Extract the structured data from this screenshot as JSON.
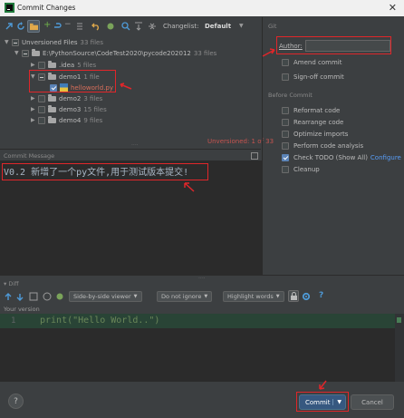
{
  "window": {
    "title": "Commit Changes",
    "close_glyph": "✕"
  },
  "toolbar": {
    "changelist_label": "Changelist:",
    "changelist_value": "Default"
  },
  "tree": {
    "root": {
      "label": "Unversioned Files",
      "count": "33 files"
    },
    "path": {
      "label": "E:\\PythonSource\\CodeTest2020\\pycode202012",
      "count": "33 files"
    },
    "items": [
      {
        "label": ".idea",
        "count": "5 files"
      },
      {
        "label": "demo1",
        "count": "1 file"
      },
      {
        "label": "helloworld.py",
        "count": ""
      },
      {
        "label": "demo2",
        "count": "3 files"
      },
      {
        "label": "demo3",
        "count": "15 files"
      },
      {
        "label": "demo4",
        "count": "9 files"
      }
    ],
    "status": "Unversioned: 1 of 33"
  },
  "commit_message": {
    "label": "Commit Message",
    "value": "V0.2 新增了一个py文件,用于测试版本提交!"
  },
  "git": {
    "header": "Git",
    "author_label": "Author:",
    "author_value": "",
    "amend": "Amend commit",
    "signoff": "Sign-off commit"
  },
  "before_commit": {
    "header": "Before Commit",
    "options": [
      {
        "label": "Reformat code",
        "checked": false
      },
      {
        "label": "Rearrange code",
        "checked": false
      },
      {
        "label": "Optimize imports",
        "checked": false
      },
      {
        "label": "Perform code analysis",
        "checked": false
      },
      {
        "label": "Check TODO (Show All)",
        "checked": true,
        "link": "Configure"
      },
      {
        "label": "Cleanup",
        "checked": false
      }
    ]
  },
  "diff": {
    "header": "Diff",
    "viewer": "Side-by-side viewer",
    "ignore": "Do not ignore",
    "highlight": "Highlight words",
    "your_version": "Your version",
    "line_number": "1",
    "code": "print(\"Hello World..\")"
  },
  "footer": {
    "help": "?",
    "commit": "Commit",
    "cancel": "Cancel"
  },
  "colors": {
    "accent_red": "#e0262a",
    "commit_blue": "#365880",
    "link": "#589df6",
    "string_green": "#6a8759"
  }
}
